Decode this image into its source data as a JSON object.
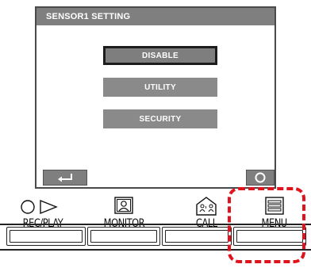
{
  "screen": {
    "title": "SENSOR1 SETTING",
    "options": [
      {
        "label": "DISABLE",
        "selected": true
      },
      {
        "label": "UTILITY",
        "selected": false
      },
      {
        "label": "SECURITY",
        "selected": false
      }
    ],
    "soft_keys": {
      "back_icon": "return-arrow-icon",
      "ok_icon": "circle-icon"
    }
  },
  "keys": [
    {
      "label": "REC/PLAY",
      "icon": "record-play-icon"
    },
    {
      "label": "MONITOR",
      "icon": "monitor-person-icon"
    },
    {
      "label": "CALL",
      "icon": "call-house-icon"
    },
    {
      "label": "MENU",
      "icon": "menu-list-icon"
    }
  ],
  "colors": {
    "title_bar": "#7f7f7f",
    "option": "#8a8a8a",
    "highlight": "#e0121b"
  }
}
